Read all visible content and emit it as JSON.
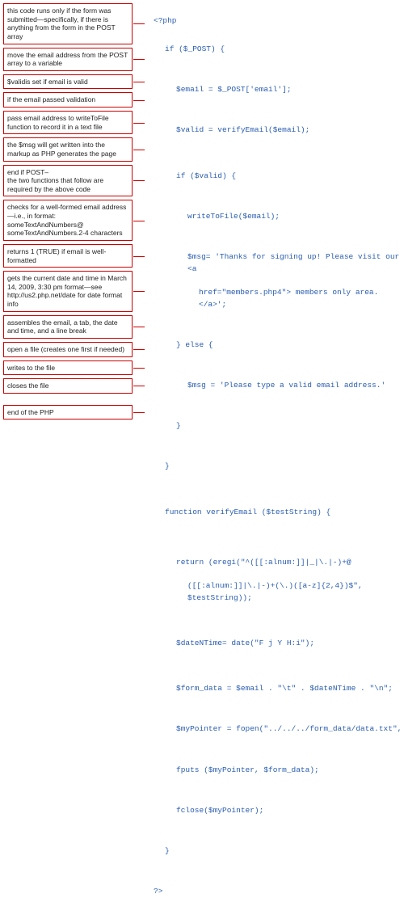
{
  "annotations": [
    "this code runs only if the form was submitted—specifically, if there is anything from the form in the POST array",
    "move the email address from the POST array to a variable",
    "$validis set if email is valid",
    "if the email passed validation",
    "pass email address to writeToFile function to record it in a text file",
    "the $msg will get written into the markup as PHP generates the page",
    "end if POST–\nthe two functions that follow are required by the above code",
    "checks for a well-formed email address—i.e., in format: someTextAndNumbers@ someTextAndNumbers.2-4 characters",
    "returns 1 (TRUE) if email is well-formatted",
    "gets the current date and time in March 14, 2009, 3:30 pm format—see http://us2.php.net/date for date format info",
    "assembles the email,  a tab, the date and time, and a line break",
    "open a file (creates one first if needed)",
    "writes to the file",
    "closes the file",
    "end of the PHP"
  ],
  "code": {
    "l0": "<?php",
    "l1": "if ($_POST) {",
    "l2": "$email = $_POST['email'];",
    "l3": "$valid = verifyEmail($email);",
    "l4": "if ($valid) {",
    "l5": "writeToFile($email);",
    "l6a": "$msg= 'Thanks for signing up! Please visit our <a",
    "l6b": "href=\"members.php4\"> members only area.</a>';",
    "l7": "} else {",
    "l8": "$msg = 'Please type a valid email address.'",
    "l9": "}",
    "l10": "}",
    "l11": "function verifyEmail ($testString) {",
    "l12a": "return (eregi(\"^([[:alnum:]]|_|\\.|-)+@",
    "l12b": "([[:alnum:]]|\\.|-)+(\\.)([a-z]{2,4})$\", $testString));",
    "l13": "$dateNTime= date(\"F j Y H:i\");",
    "l14": "$form_data = $email . \"\\t\" . $dateNTime . \"\\n\";",
    "l15": "$myPointer = fopen(\"../../../form_data/data.txt\", \"r+\");",
    "l16": "fputs ($myPointer, $form_data);",
    "l17": "fclose($myPointer);",
    "l18": "}",
    "l19": "?>"
  }
}
